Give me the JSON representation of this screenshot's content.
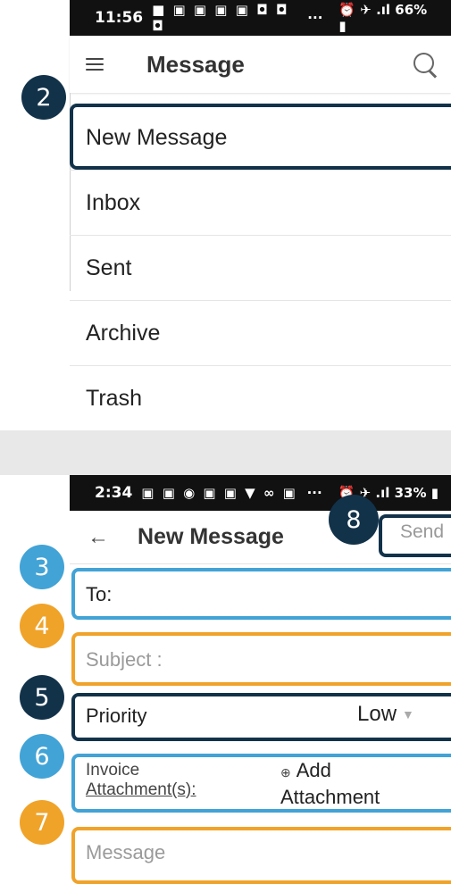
{
  "top_status": {
    "time": "11:56",
    "icons": "■ ▣ ▣ ▣ ▣ ◘ ◘ ◘",
    "dots": "···",
    "right": "⏰ ✈ .ıl 66% ▮"
  },
  "top_header": {
    "title": "Message",
    "menu_icon": "hamburger-icon",
    "search_icon": "search-icon"
  },
  "menu": {
    "items": [
      {
        "label": "New Message"
      },
      {
        "label": "Inbox"
      },
      {
        "label": "Sent"
      },
      {
        "label": "Archive"
      },
      {
        "label": "Trash"
      }
    ]
  },
  "bottom_status": {
    "time": "2:34",
    "icons": "▣ ▣ ◉ ▣ ▣ ▼ ∞ ▣",
    "dots": "···",
    "right": "⏰ ✈ .ıl 33% ▮"
  },
  "compose": {
    "back_icon": "back-arrow-icon",
    "title": "New Message",
    "send_label": "Send",
    "to_label": "To:",
    "subject_placeholder": "Subject :",
    "priority_label": "Priority",
    "priority_value": "Low",
    "attachment_label_line1": "Invoice",
    "attachment_label_line2": "Attachment(s):",
    "add_attachment_line1": "Add",
    "add_attachment_line2": "Attachment",
    "message_placeholder": "Message"
  },
  "callouts": {
    "badge_2": "2",
    "badge_3": "3",
    "badge_4": "4",
    "badge_5": "5",
    "badge_6": "6",
    "badge_7": "7",
    "badge_8": "8",
    "colors": {
      "navy": "#12324a",
      "blue": "#42a3d6",
      "orange": "#f0a329"
    }
  }
}
